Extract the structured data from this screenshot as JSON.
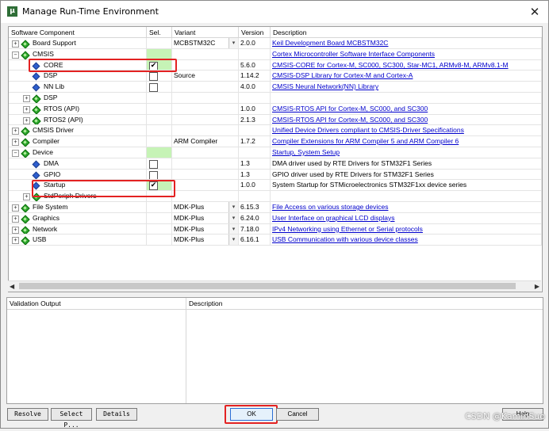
{
  "window": {
    "title": "Manage Run-Time Environment",
    "close": "✕"
  },
  "grid": {
    "headers": [
      "Software Component",
      "Sel.",
      "Variant",
      "Version",
      "Description"
    ],
    "rows": [
      {
        "level": 0,
        "exp": "+",
        "icon": "dia",
        "name": "Board Support",
        "sel": null,
        "green": false,
        "variant": "MCBSTM32C",
        "dropdown": true,
        "version": "2.0.0",
        "desc": "Keil Development Board MCBSTM32C",
        "link": true
      },
      {
        "level": 0,
        "exp": "−",
        "icon": "dia",
        "name": "CMSIS",
        "sel": null,
        "green": true,
        "variant": "",
        "dropdown": false,
        "version": "",
        "desc": "Cortex Microcontroller Software Interface Components",
        "link": true
      },
      {
        "level": 1,
        "exp": "",
        "icon": "gem",
        "name": "CORE",
        "sel": "✔",
        "green": true,
        "variant": "",
        "dropdown": false,
        "version": "5.6.0",
        "desc": "CMSIS-CORE for Cortex-M, SC000, SC300, Star-MC1, ARMv8-M, ARMv8.1-M",
        "link": true
      },
      {
        "level": 1,
        "exp": "",
        "icon": "gem",
        "name": "DSP",
        "sel": "",
        "green": false,
        "variant": "Source",
        "dropdown": false,
        "version": "1.14.2",
        "desc": "CMSIS-DSP Library for Cortex-M and Cortex-A",
        "link": true
      },
      {
        "level": 1,
        "exp": "",
        "icon": "gem",
        "name": "NN Lib",
        "sel": "",
        "green": false,
        "variant": "",
        "dropdown": false,
        "version": "4.0.0",
        "desc": "CMSIS Neural Network(NN) Library",
        "link": true
      },
      {
        "level": 1,
        "exp": "+",
        "icon": "dia",
        "name": "DSP",
        "sel": null,
        "green": false,
        "variant": "",
        "dropdown": false,
        "version": "",
        "desc": "",
        "link": false
      },
      {
        "level": 1,
        "exp": "+",
        "icon": "dia",
        "name": "RTOS (API)",
        "sel": null,
        "green": false,
        "variant": "",
        "dropdown": false,
        "version": "1.0.0",
        "desc": "CMSIS-RTOS API for Cortex-M, SC000, and SC300",
        "link": true
      },
      {
        "level": 1,
        "exp": "+",
        "icon": "dia",
        "name": "RTOS2 (API)",
        "sel": null,
        "green": false,
        "variant": "",
        "dropdown": false,
        "version": "2.1.3",
        "desc": "CMSIS-RTOS API for Cortex-M, SC000, and SC300",
        "link": true
      },
      {
        "level": 0,
        "exp": "+",
        "icon": "dia",
        "name": "CMSIS Driver",
        "sel": null,
        "green": false,
        "variant": "",
        "dropdown": false,
        "version": "",
        "desc": "Unified Device Drivers compliant to CMSIS-Driver Specifications",
        "link": true
      },
      {
        "level": 0,
        "exp": "+",
        "icon": "dia",
        "name": "Compiler",
        "sel": null,
        "green": false,
        "variant": "ARM Compiler",
        "dropdown": false,
        "version": "1.7.2",
        "desc": "Compiler Extensions for ARM Compiler 5 and ARM Compiler 6",
        "link": true
      },
      {
        "level": 0,
        "exp": "−",
        "icon": "dia",
        "name": "Device",
        "sel": null,
        "green": true,
        "variant": "",
        "dropdown": false,
        "version": "",
        "desc": "Startup, System Setup",
        "link": true
      },
      {
        "level": 1,
        "exp": "",
        "icon": "gem",
        "name": "DMA",
        "sel": "",
        "green": false,
        "variant": "",
        "dropdown": false,
        "version": "1.3",
        "desc": "DMA driver used by RTE Drivers for STM32F1 Series",
        "link": false
      },
      {
        "level": 1,
        "exp": "",
        "icon": "gem",
        "name": "GPIO",
        "sel": "",
        "green": false,
        "variant": "",
        "dropdown": false,
        "version": "1.3",
        "desc": "GPIO driver used by RTE Drivers for STM32F1 Series",
        "link": false
      },
      {
        "level": 1,
        "exp": "",
        "icon": "gem",
        "name": "Startup",
        "sel": "✔",
        "green": true,
        "variant": "",
        "dropdown": false,
        "version": "1.0.0",
        "desc": "System Startup for STMicroelectronics STM32F1xx device series",
        "link": false
      },
      {
        "level": 1,
        "exp": "+",
        "icon": "dia",
        "name": "StdPeriph Drivers",
        "sel": null,
        "green": false,
        "variant": "",
        "dropdown": false,
        "version": "",
        "desc": "",
        "link": false
      },
      {
        "level": 0,
        "exp": "+",
        "icon": "dia",
        "name": "File System",
        "sel": null,
        "green": false,
        "variant": "MDK-Plus",
        "dropdown": true,
        "version": "6.15.3",
        "desc": "File Access on various storage devices",
        "link": true
      },
      {
        "level": 0,
        "exp": "+",
        "icon": "dia",
        "name": "Graphics",
        "sel": null,
        "green": false,
        "variant": "MDK-Plus",
        "dropdown": true,
        "version": "6.24.0",
        "desc": "User Interface on graphical LCD displays",
        "link": true
      },
      {
        "level": 0,
        "exp": "+",
        "icon": "dia",
        "name": "Network",
        "sel": null,
        "green": false,
        "variant": "MDK-Plus",
        "dropdown": true,
        "version": "7.18.0",
        "desc": "IPv4 Networking using Ethernet or Serial protocols",
        "link": true
      },
      {
        "level": 0,
        "exp": "+",
        "icon": "dia",
        "name": "USB",
        "sel": null,
        "green": false,
        "variant": "MDK-Plus",
        "dropdown": true,
        "version": "6.16.1",
        "desc": "USB Communication with various device classes",
        "link": true
      }
    ]
  },
  "validation": {
    "headers": [
      "Validation Output",
      "Description"
    ]
  },
  "buttons": {
    "resolve": "Resolve",
    "select": "Select P...",
    "details": "Details",
    "ok": "OK",
    "cancel": "Cancel",
    "help": "Help"
  },
  "watermark": "CSDN @KaminSuo",
  "colors": {
    "selected_green": "#c6f3b6",
    "link_blue": "#0000cc",
    "highlight_red": "#e32222",
    "icon_green": "#2fa82f",
    "icon_blue": "#2e5fd0"
  }
}
